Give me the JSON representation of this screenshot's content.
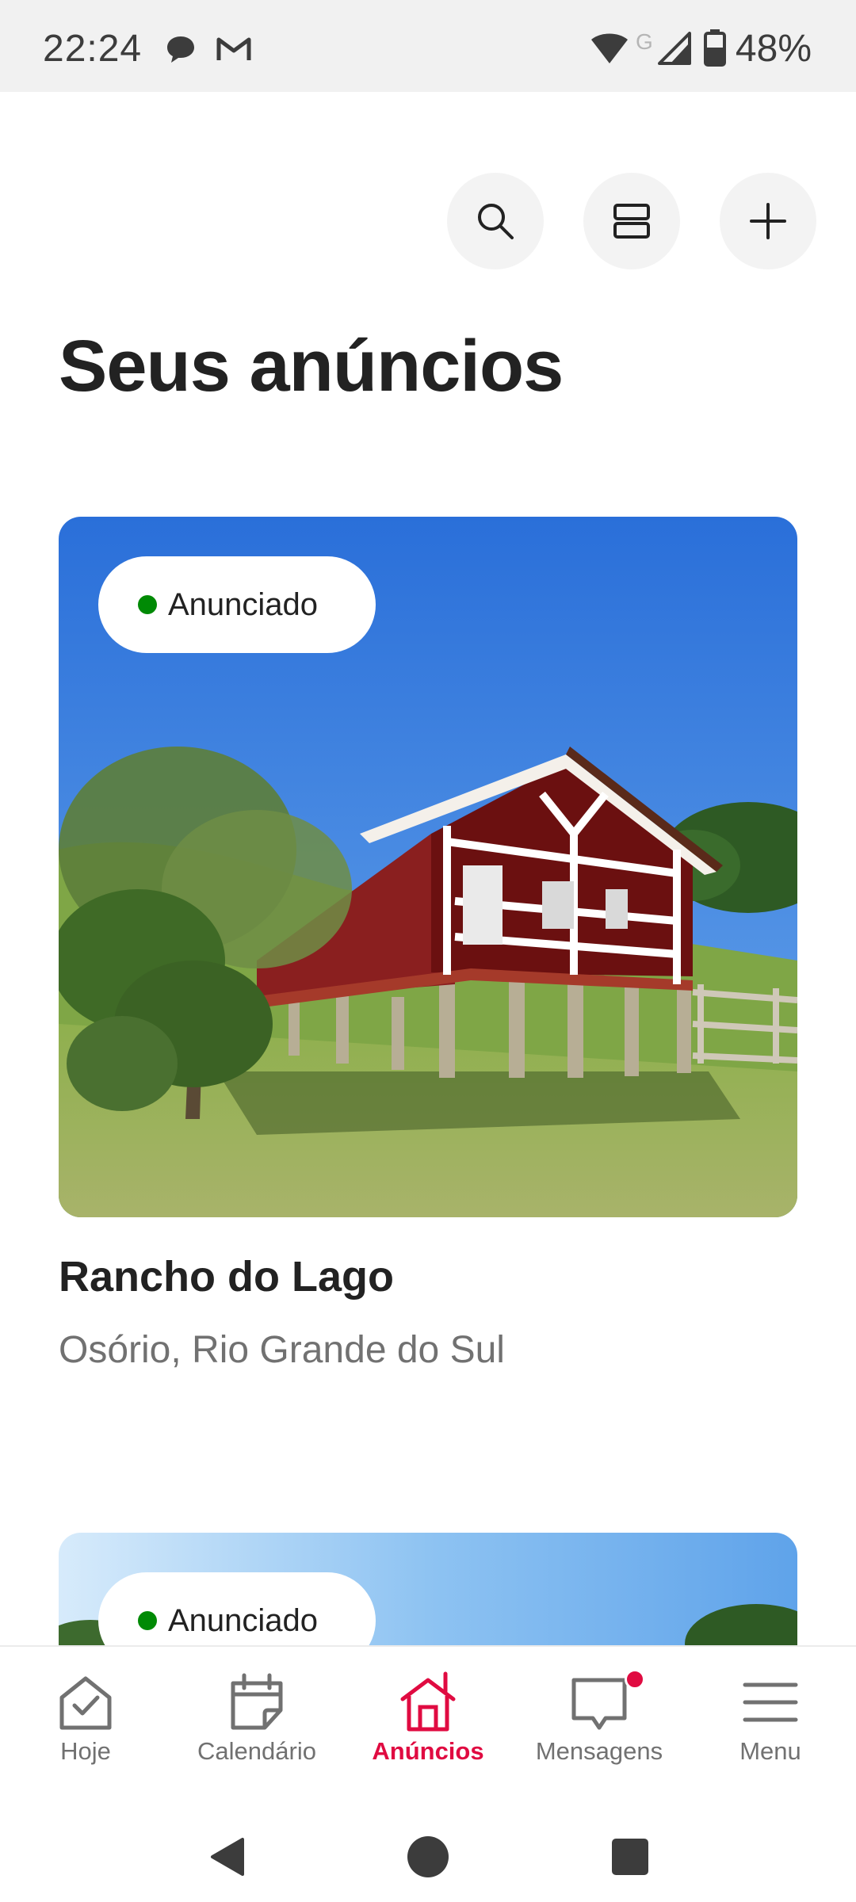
{
  "status_bar": {
    "time": "22:24",
    "battery": "48%",
    "icons": [
      "chat-bubble-icon",
      "gmail-icon",
      "wifi-icon",
      "g-network-icon",
      "signal-icon",
      "battery-icon"
    ]
  },
  "header": {
    "buttons": [
      "search-icon",
      "view-toggle-icon",
      "plus-icon"
    ]
  },
  "page_title": "Seus anúncios",
  "listings": [
    {
      "status": "Anunciado",
      "status_color": "#008a05",
      "title": "Rancho do Lago",
      "location": "Osório, Rio Grande do Sul"
    },
    {
      "status": "Anunciado",
      "status_color": "#008a05"
    }
  ],
  "bottom_nav": {
    "accent_color": "#e00b41",
    "items": [
      {
        "label": "Hoje",
        "icon": "house-check-icon"
      },
      {
        "label": "Calendário",
        "icon": "calendar-icon"
      },
      {
        "label": "Anúncios",
        "icon": "listing-house-icon",
        "active": true
      },
      {
        "label": "Mensagens",
        "icon": "message-icon",
        "badge": true
      },
      {
        "label": "Menu",
        "icon": "hamburger-menu-icon"
      }
    ]
  },
  "system_nav": [
    "back-icon",
    "home-icon",
    "recents-icon"
  ]
}
